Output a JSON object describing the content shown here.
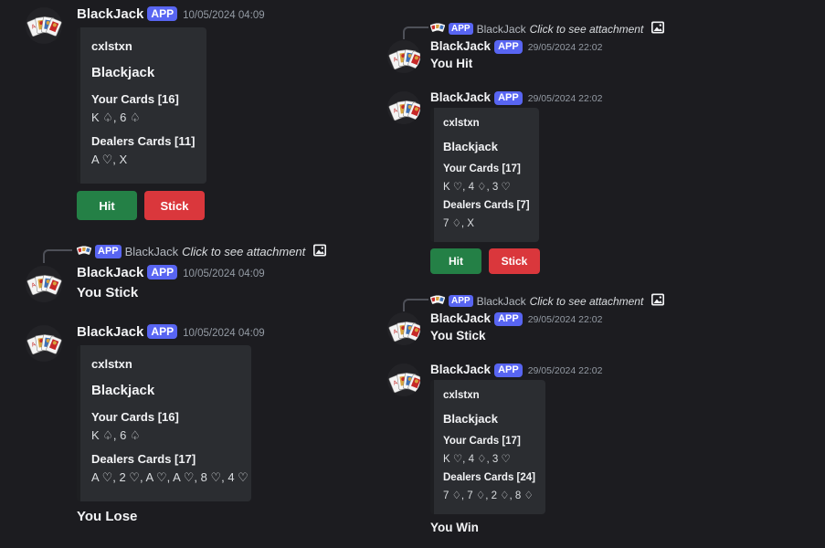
{
  "bot": {
    "name": "BlackJack",
    "badge": "APP"
  },
  "reply_link": "Click to see attachment",
  "left": {
    "msg1": {
      "timestamp": "10/05/2024 04:09",
      "embed": {
        "author": "cxlstxn",
        "title": "Blackjack",
        "your_label": "Your Cards [16]",
        "your_cards": "K ♤, 6 ♤",
        "dealer_label": "Dealers Cards [11]",
        "dealer_cards": "A ♡, X"
      },
      "buttons": {
        "hit": "Hit",
        "stick": "Stick"
      }
    },
    "msg2": {
      "timestamp": "10/05/2024 04:09",
      "text": "You Stick"
    },
    "msg3": {
      "timestamp": "10/05/2024 04:09",
      "embed": {
        "author": "cxlstxn",
        "title": "Blackjack",
        "your_label": "Your Cards [16]",
        "your_cards": "K ♤, 6 ♤",
        "dealer_label": "Dealers Cards [17]",
        "dealer_cards": "A ♡, 2 ♡, A ♡, A ♡, 8 ♡, 4 ♡"
      },
      "result": "You Lose"
    }
  },
  "right": {
    "msg1": {
      "timestamp": "29/05/2024 22:02",
      "text": "You Hit"
    },
    "msg2": {
      "timestamp": "29/05/2024 22:02",
      "embed": {
        "author": "cxlstxn",
        "title": "Blackjack",
        "your_label": "Your Cards [17]",
        "your_cards": "K ♡, 4 ♢, 3 ♡",
        "dealer_label": "Dealers Cards [7]",
        "dealer_cards": "7 ♢, X"
      },
      "buttons": {
        "hit": "Hit",
        "stick": "Stick"
      }
    },
    "msg3": {
      "timestamp": "29/05/2024 22:02",
      "text": "You Stick"
    },
    "msg4": {
      "timestamp": "29/05/2024 22:02",
      "embed": {
        "author": "cxlstxn",
        "title": "Blackjack",
        "your_label": "Your Cards [17]",
        "your_cards": "K ♡, 4 ♢, 3 ♡",
        "dealer_label": "Dealers Cards [24]",
        "dealer_cards": "7 ♢, 7 ♢, 2 ♢, 8 ♢"
      },
      "result": "You Win"
    }
  },
  "icons": {
    "avatar": "playing-cards-icon",
    "attachment": "image-icon"
  }
}
